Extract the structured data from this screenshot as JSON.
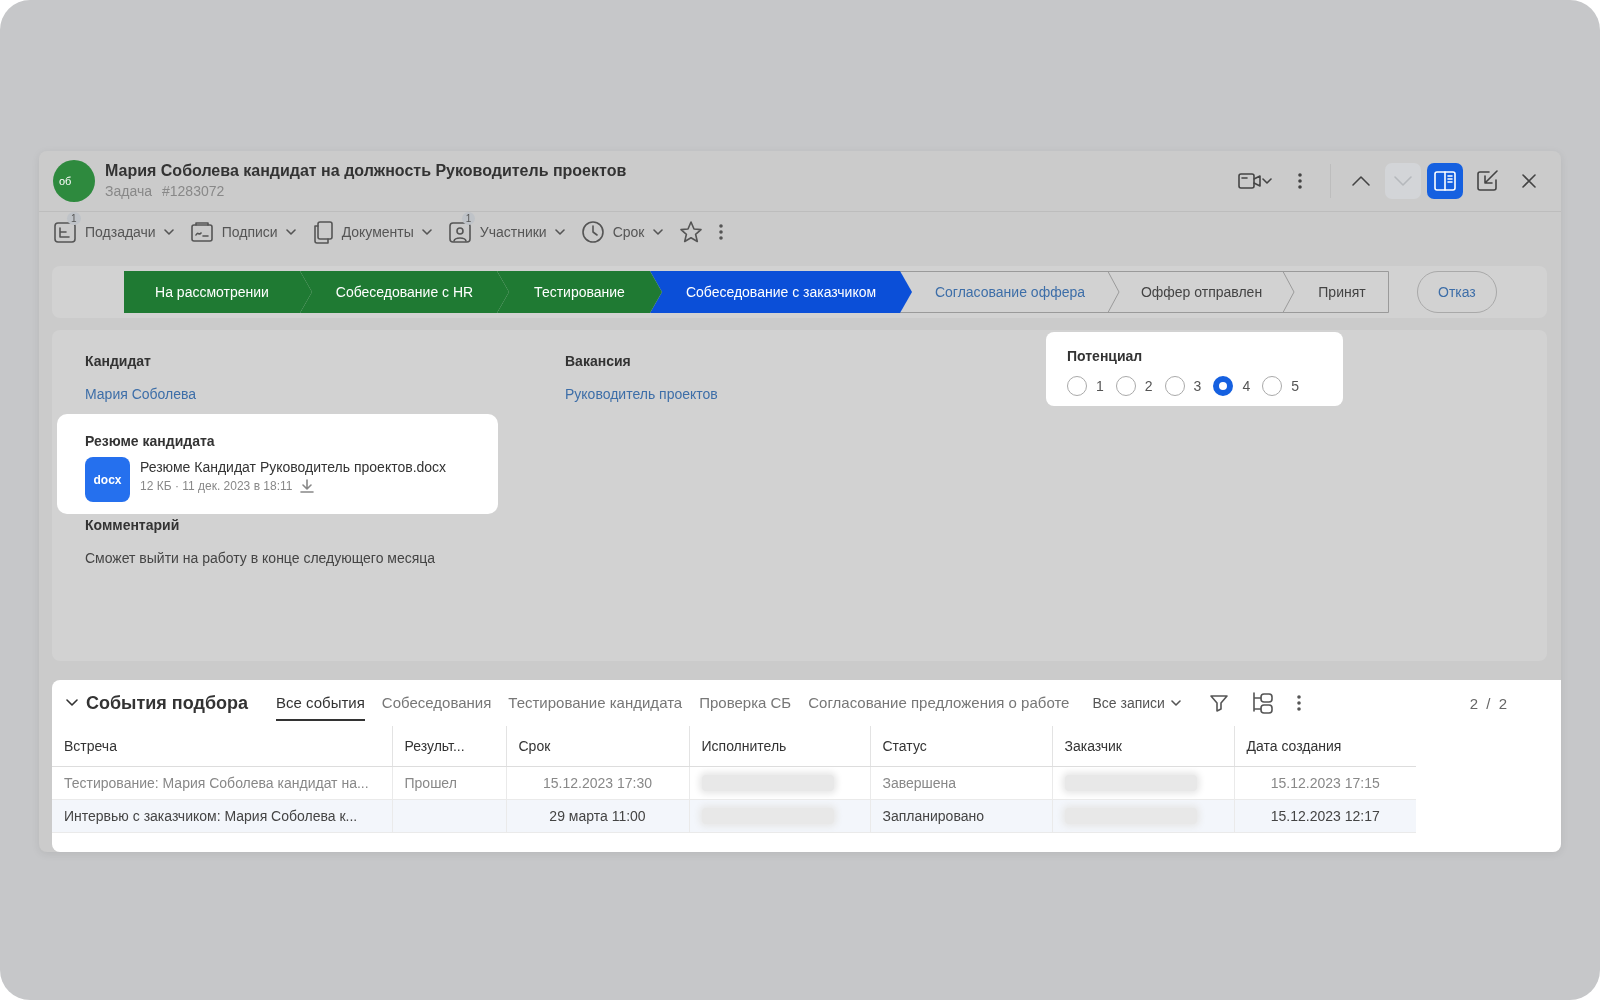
{
  "header": {
    "avatar_initials": "об",
    "title": "Мария Соболева кандидат на должность Руководитель проектов",
    "type": "Задача",
    "number": "#1283072"
  },
  "header_actions": [
    {
      "kind": "video",
      "disabled": false,
      "active": false
    },
    {
      "kind": "more",
      "disabled": false,
      "active": false
    },
    {
      "kind": "up",
      "disabled": false,
      "active": false
    },
    {
      "kind": "down",
      "disabled": true,
      "active": false
    },
    {
      "kind": "panel",
      "disabled": false,
      "active": true
    },
    {
      "kind": "undock",
      "disabled": false,
      "active": false
    },
    {
      "kind": "close",
      "disabled": false,
      "active": false
    }
  ],
  "toolbar": [
    {
      "kind": "subtasks",
      "label": "Подзадачи",
      "badge": "1"
    },
    {
      "kind": "signatures",
      "label": "Подписи"
    },
    {
      "kind": "documents",
      "label": "Документы"
    },
    {
      "kind": "participants",
      "label": "Участники",
      "badge": "1"
    },
    {
      "kind": "deadline",
      "label": "Срок"
    },
    {
      "kind": "star"
    },
    {
      "kind": "more"
    }
  ],
  "stages": [
    {
      "label": "На рассмотрении",
      "kind": "done"
    },
    {
      "label": "Собеседование с HR",
      "kind": "done"
    },
    {
      "label": "Тестирование",
      "kind": "done"
    },
    {
      "label": "Собеседование с заказчиком",
      "kind": "current"
    },
    {
      "label": "Согласование оффера",
      "kind": "next"
    },
    {
      "label": "Оффер отправлен",
      "kind": "pending"
    },
    {
      "label": "Принят",
      "kind": "pending"
    }
  ],
  "reject_button": {
    "label": "Отказ"
  },
  "fields": {
    "candidate": {
      "label": "Кандидат",
      "value": "Мария Соболева"
    },
    "vacancy": {
      "label": "Вакансия",
      "value": "Руководитель проектов"
    },
    "resume": {
      "label": "Резюме кандидата",
      "file": {
        "type": "docx",
        "name": "Резюме Кандидат Руководитель проектов.docx",
        "meta": "12 КБ · 11 дек. 2023 в 18:11"
      }
    },
    "comment": {
      "label": "Комментарий",
      "value": "Сможет выйти на работу в конце следующего месяца"
    },
    "potential": {
      "label": "Потенциал",
      "options": [
        {
          "label": "1",
          "selected": false
        },
        {
          "label": "2",
          "selected": false
        },
        {
          "label": "3",
          "selected": false
        },
        {
          "label": "4",
          "selected": true
        },
        {
          "label": "5",
          "selected": false
        }
      ]
    }
  },
  "events": {
    "title": "События подбора",
    "expanded": true,
    "tabs": [
      {
        "label": "Все события",
        "selected": true
      },
      {
        "label": "Собеседования",
        "selected": false
      },
      {
        "label": "Тестирование кандидата",
        "selected": false
      },
      {
        "label": "Проверка СБ",
        "selected": false
      },
      {
        "label": "Согласование предложения о работе",
        "selected": false
      }
    ],
    "filter": {
      "label": "Все записи"
    },
    "counter": "2 / 2",
    "table": {
      "columns": [
        "Встреча",
        "Результ...",
        "Срок",
        "Исполнитель",
        "Статус",
        "Заказчик",
        "Дата создания"
      ],
      "rows": [
        {
          "selected": false,
          "muted": true,
          "cells": [
            {
              "kind": "text",
              "text": "Тестирование: Мария Соболева кандидат на..."
            },
            {
              "kind": "text",
              "text": "Прошел"
            },
            {
              "kind": "date",
              "text": "15.12.2023 17:30"
            },
            {
              "kind": "redacted"
            },
            {
              "kind": "text",
              "text": "Завершена"
            },
            {
              "kind": "redacted"
            },
            {
              "kind": "date",
              "text": "15.12.2023 17:15"
            }
          ]
        },
        {
          "selected": true,
          "muted": false,
          "cells": [
            {
              "kind": "text",
              "text": "Интервью с заказчиком: Мария Соболева к..."
            },
            {
              "kind": "empty"
            },
            {
              "kind": "date",
              "text": "29 марта 11:00"
            },
            {
              "kind": "redacted"
            },
            {
              "kind": "text",
              "text": "Запланировано"
            },
            {
              "kind": "redacted"
            },
            {
              "kind": "date",
              "text": "15.12.2023 12:17"
            }
          ]
        }
      ]
    }
  }
}
